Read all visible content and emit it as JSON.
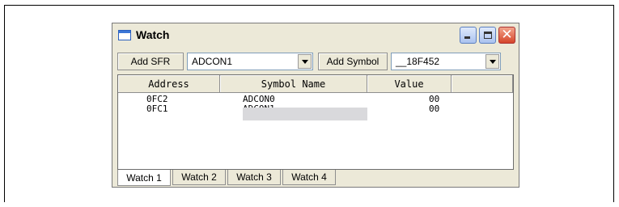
{
  "window": {
    "title": "Watch"
  },
  "toolbar": {
    "add_sfr_label": "Add SFR",
    "sfr_select_value": "ADCON1",
    "add_symbol_label": "Add Symbol",
    "symbol_select_value": "__18F452"
  },
  "table": {
    "columns": [
      "Address",
      "Symbol Name",
      "Value"
    ],
    "rows": [
      {
        "address": "0FC2",
        "symbol": "ADCON0",
        "value": "00"
      },
      {
        "address": "0FC1",
        "symbol": "ADCON1",
        "value": "00"
      }
    ]
  },
  "tabs": [
    "Watch 1",
    "Watch 2",
    "Watch 3",
    "Watch 4"
  ],
  "icons": {
    "window": "watch-window-icon",
    "minimize": "minimize-icon",
    "maximize": "maximize-icon",
    "close": "close-icon",
    "dropdown": "chevron-down-icon"
  }
}
